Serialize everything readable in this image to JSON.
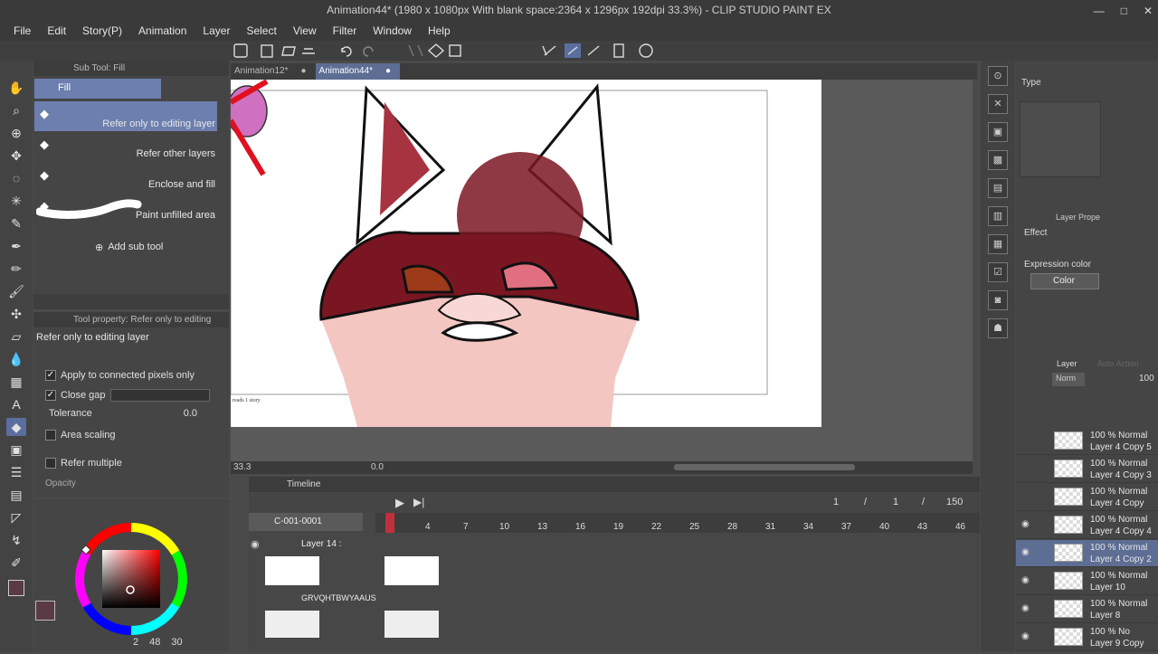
{
  "window": {
    "title": "Animation44* (1980 x 1080px With blank space:2364 x 1296px 192dpi 33.3%) - CLIP STUDIO PAINT EX",
    "controls": [
      "—",
      "□",
      "✕"
    ]
  },
  "menu": [
    "File",
    "Edit",
    "Story(P)",
    "Animation",
    "Layer",
    "Select",
    "View",
    "Filter",
    "Window",
    "Help"
  ],
  "doc_tabs": [
    {
      "label": "Animation12*",
      "close": "●"
    },
    {
      "label": "Animation44*",
      "close": "●"
    }
  ],
  "subtool": {
    "header": "Sub Tool: Fill",
    "group": "Fill",
    "items": [
      "Refer only to editing layer",
      "Refer other layers",
      "Enclose and fill",
      "Paint unfilled area"
    ],
    "add_label": "Add sub tool"
  },
  "toolprop": {
    "header": "Tool property: Refer only to editing",
    "current": "Refer only to editing layer",
    "apply_connected": "Apply to connected pixels only",
    "close_gap": "Close gap",
    "tolerance_label": "Tolerance",
    "tolerance_value": "0.0",
    "area_scaling": "Area scaling",
    "refer_multiple": "Refer multiple",
    "opacity": "Opacity"
  },
  "color": {
    "main": "#5a3a44",
    "sub": "#ffffff",
    "footer": [
      "2",
      "48",
      "30"
    ]
  },
  "canvas": {
    "caption": "reads 1 story"
  },
  "navigator": {
    "zoom": "33.3",
    "angle": "0.0"
  },
  "timeline": {
    "title": "Timeline",
    "track": "C-001-0001",
    "frame_current": "1",
    "frame_start": "1",
    "frame_end": "150",
    "separator": "/",
    "ruler": [
      "1",
      "4",
      "7",
      "10",
      "13",
      "16",
      "19",
      "22",
      "25",
      "28",
      "31",
      "34",
      "37",
      "40",
      "43",
      "46"
    ],
    "tracks": [
      {
        "name": "Layer 14 :"
      },
      {
        "name": "GRVQHTBWYAAUS"
      }
    ]
  },
  "right_panel": {
    "type_label": "Type",
    "layer_prop_label": "Layer Prope",
    "effect_label": "Effect",
    "expression_label": "Expression color",
    "expression_value": "Color",
    "layer_tab": "Layer",
    "auto_action_tab": "Auto Action",
    "blend_mode": "Norm",
    "opacity": "100",
    "layers": [
      {
        "mode": "100 % Normal",
        "name": "Layer 4 Copy 5",
        "visible": false
      },
      {
        "mode": "100 % Normal",
        "name": "Layer 4 Copy 3",
        "visible": false
      },
      {
        "mode": "100 % Normal",
        "name": "Layer 4 Copy",
        "visible": false
      },
      {
        "mode": "100 % Normal",
        "name": "Layer 4 Copy 4",
        "visible": true
      },
      {
        "mode": "100 % Normal",
        "name": "Layer 4 Copy 2",
        "visible": true,
        "selected": true
      },
      {
        "mode": "100 % Normal",
        "name": "Layer 10",
        "visible": true
      },
      {
        "mode": "100 % Normal",
        "name": "Layer 8",
        "visible": true
      },
      {
        "mode": "100 % No",
        "name": "Layer 9 Copy",
        "visible": true
      }
    ]
  }
}
